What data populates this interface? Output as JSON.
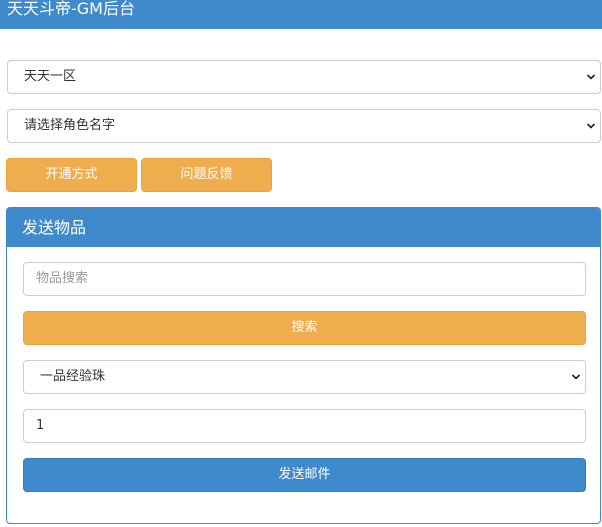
{
  "header": {
    "title": "天天斗帝-GM后台"
  },
  "server_select": {
    "value": "天天一区"
  },
  "role_select": {
    "value": "请选择角色名字"
  },
  "buttons": {
    "open_method": "开通方式",
    "feedback": "问题反馈"
  },
  "send_panel": {
    "title": "发送物品",
    "search_input": {
      "placeholder": "物品搜索",
      "value": ""
    },
    "search_button": "搜索",
    "item_select": {
      "value": "一品经验珠"
    },
    "quantity_input": {
      "value": "1"
    },
    "send_button": "发送邮件"
  },
  "colors": {
    "primary_blue": "#3e8acc",
    "warning_orange": "#f0ad4e"
  },
  "icons": [
    "chevron-down-icon"
  ]
}
